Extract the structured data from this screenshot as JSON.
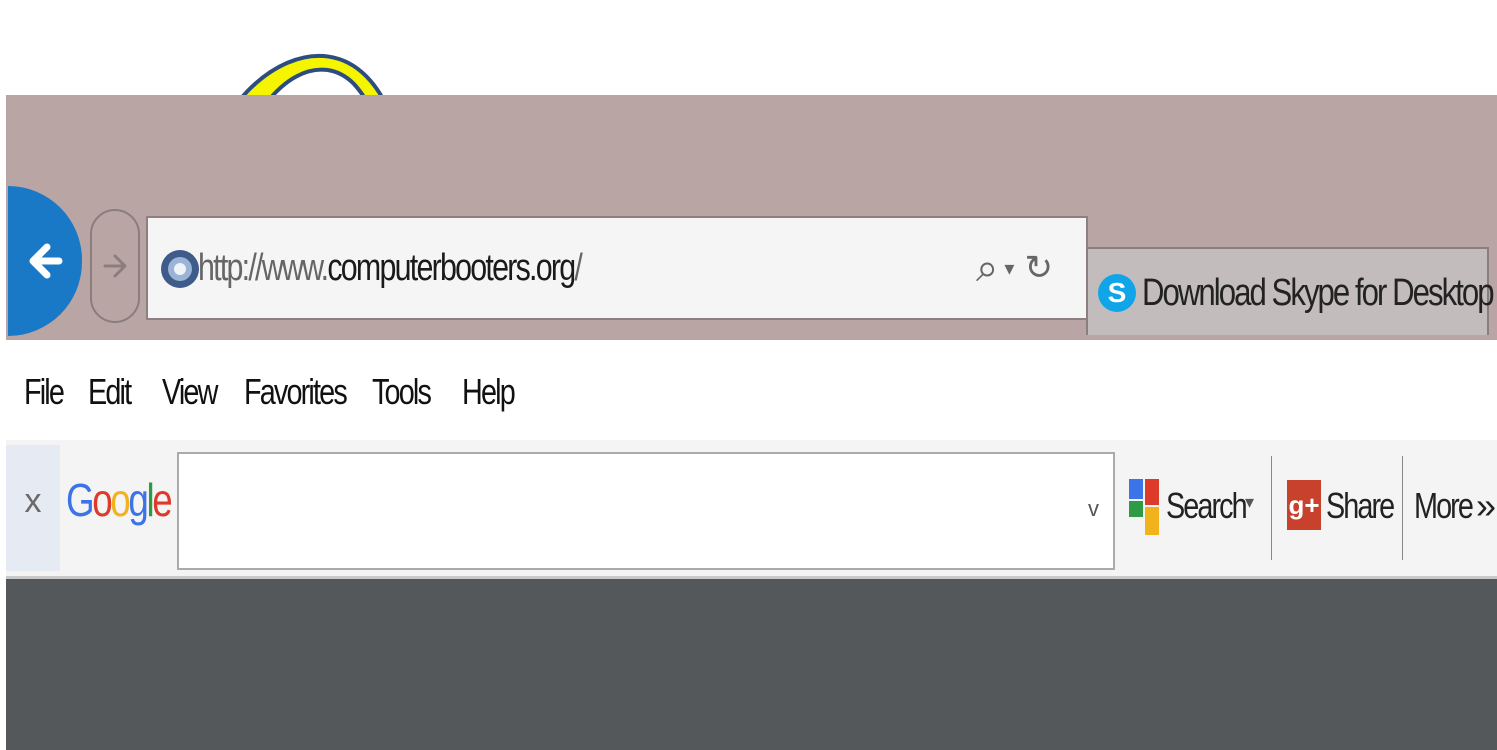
{
  "browser": {
    "address_bar": {
      "url_prefix": "http://www.",
      "url_domain": "computerbooters.org",
      "url_suffix": "/",
      "search_glyph": "⌕",
      "dropdown_glyph": "▾",
      "refresh_glyph": "↻"
    },
    "tab": {
      "title": "Download Skype for Desktop",
      "icon_letter": "S"
    }
  },
  "menu": {
    "items": [
      "File",
      "Edit",
      "View",
      "Favorites",
      "Tools",
      "Help"
    ]
  },
  "google_toolbar": {
    "close_label": "x",
    "logo_letters": [
      {
        "char": "G",
        "color": "#3b73e8"
      },
      {
        "char": "o",
        "color": "#dd3a2a"
      },
      {
        "char": "o",
        "color": "#f2b21c"
      },
      {
        "char": "g",
        "color": "#3b73e8"
      },
      {
        "char": "l",
        "color": "#2f9a45"
      },
      {
        "char": "e",
        "color": "#dd3a2a"
      }
    ],
    "search_input": {
      "value": "",
      "placeholder": ""
    },
    "dropdown_chevron": "v",
    "search_label": "Search",
    "search_caret": "▾",
    "share_icon_text": "g+",
    "share_label": "Share",
    "more_label": "More",
    "more_glyph": "»"
  },
  "colors": {
    "titlebar": "#b9a5a3",
    "back_button": "#1a79c6",
    "content": "#55585b",
    "annotation_arrow": "#f5f500"
  }
}
